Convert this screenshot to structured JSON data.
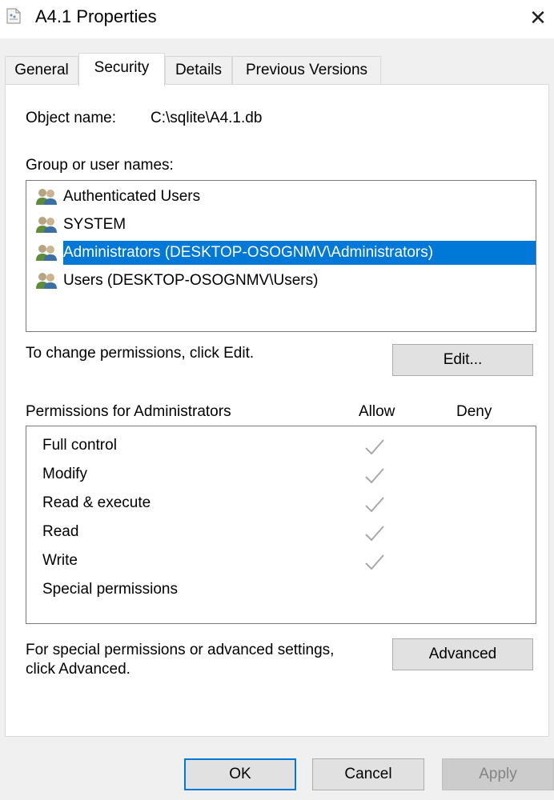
{
  "window": {
    "title": "A4.1 Properties",
    "close_glyph": "✕"
  },
  "tabs": [
    {
      "label": "General",
      "active": false
    },
    {
      "label": "Security",
      "active": true
    },
    {
      "label": "Details",
      "active": false
    },
    {
      "label": "Previous Versions",
      "active": false
    }
  ],
  "security": {
    "object_name_label": "Object name:",
    "object_name_value": "C:\\sqlite\\A4.1.db",
    "group_label": "Group or user names:",
    "users": [
      {
        "name": "Authenticated Users",
        "selected": false
      },
      {
        "name": "SYSTEM",
        "selected": false
      },
      {
        "name": "Administrators (DESKTOP-OSOGNMV\\Administrators)",
        "selected": true
      },
      {
        "name": "Users (DESKTOP-OSOGNMV\\Users)",
        "selected": false
      }
    ],
    "change_hint": "To change permissions, click Edit.",
    "edit_button": "Edit...",
    "permissions_label": "Permissions for Administrators",
    "allow_header": "Allow",
    "deny_header": "Deny",
    "permissions": [
      {
        "name": "Full control",
        "allow": true,
        "deny": false
      },
      {
        "name": "Modify",
        "allow": true,
        "deny": false
      },
      {
        "name": "Read & execute",
        "allow": true,
        "deny": false
      },
      {
        "name": "Read",
        "allow": true,
        "deny": false
      },
      {
        "name": "Write",
        "allow": true,
        "deny": false
      },
      {
        "name": "Special permissions",
        "allow": false,
        "deny": false
      }
    ],
    "advanced_hint_line1": "For special permissions or advanced settings,",
    "advanced_hint_line2": "click Advanced.",
    "advanced_button": "Advanced"
  },
  "footer": {
    "ok": "OK",
    "cancel": "Cancel",
    "apply": "Apply"
  },
  "colors": {
    "selection": "#0078d7",
    "check_disabled": "#a8a8a8"
  }
}
